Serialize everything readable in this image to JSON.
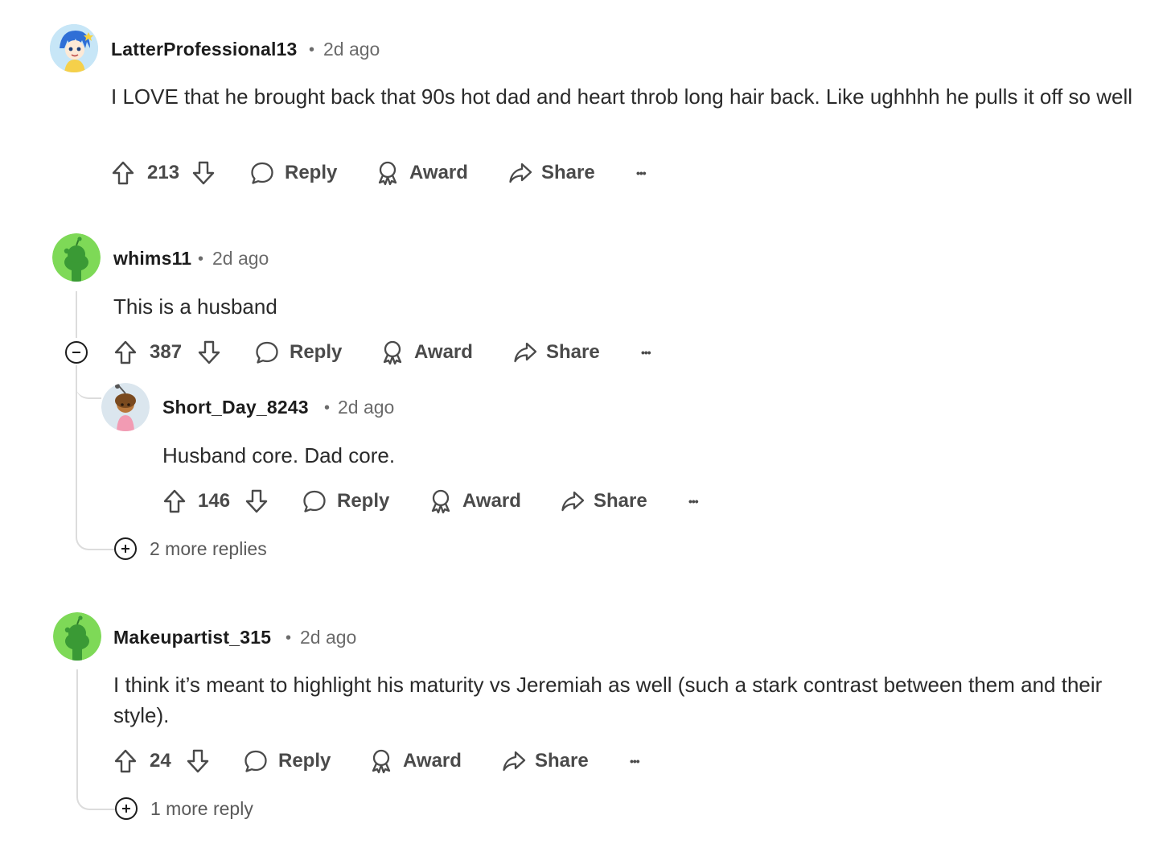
{
  "comments": [
    {
      "author": "LatterProfessional13",
      "time": "2d ago",
      "body": "I LOVE that he brought back that 90s hot dad and heart throb long hair back. Like ughhhh he pulls it off so well",
      "votes": "213"
    },
    {
      "author": "whims11",
      "time": "2d ago",
      "body": "This is a husband",
      "votes": "387",
      "replies": [
        {
          "author": "Short_Day_8243",
          "time": "2d ago",
          "body": "Husband core. Dad core.",
          "votes": "146"
        }
      ],
      "more_replies": "2 more replies"
    },
    {
      "author": "Makeupartist_315",
      "time": "2d ago",
      "body": "I think it’s meant to highlight his maturity vs Jeremiah as well (such a stark contrast between them and their style).",
      "votes": "24",
      "more_replies": "1 more reply"
    }
  ],
  "actions": {
    "reply": "Reply",
    "award": "Award",
    "share": "Share",
    "more": "•••"
  },
  "separator": "•",
  "icons": [
    "upvote-icon",
    "downvote-icon",
    "reply-icon",
    "award-icon",
    "share-icon",
    "collapse-icon",
    "expand-icon"
  ],
  "colors": {
    "snoo_green": "#7ed957",
    "text": "#1c1c1c",
    "muted": "#6b6b6b"
  }
}
